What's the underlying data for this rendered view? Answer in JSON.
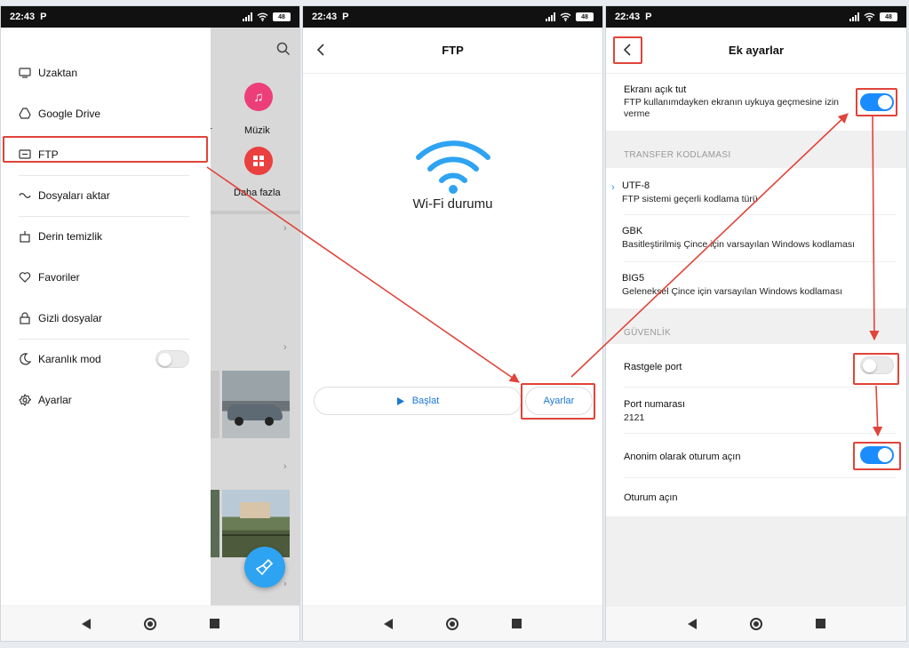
{
  "status": {
    "time": "22:43",
    "carrier_icon": "P",
    "battery": "48"
  },
  "panel1": {
    "drawer": [
      {
        "label": "Uzaktan",
        "icon": "remote-icon"
      },
      {
        "label": "Google Drive",
        "icon": "drive-icon"
      },
      {
        "label": "FTP",
        "icon": "ftp-icon"
      },
      {
        "label": "Dosyaları aktar",
        "icon": "transfer-icon"
      },
      {
        "label": "Derin temizlik",
        "icon": "clean-icon"
      },
      {
        "label": "Favoriler",
        "icon": "heart-icon"
      },
      {
        "label": "Gizli dosyalar",
        "icon": "lock-icon"
      },
      {
        "label": "Karanlık mod",
        "icon": "moon-icon"
      },
      {
        "label": "Ayarlar",
        "icon": "gear-icon"
      }
    ],
    "dark_mode_on": false,
    "bg_labels": {
      "music": "Müzik",
      "more": "Daha fazla",
      "partial": "r"
    }
  },
  "panel2": {
    "title": "FTP",
    "wifi_label": "Wi-Fi durumu",
    "start_button": "Başlat",
    "settings_button": "Ayarlar"
  },
  "panel3": {
    "title": "Ek ayarlar",
    "keep_screen": {
      "title": "Ekranı açık tut",
      "subtitle": "FTP kullanımdayken ekranın uykuya geçmesine izin verme",
      "on": true
    },
    "encoding_section": "TRANSFER KODLAMASI",
    "encodings": [
      {
        "title": "UTF-8",
        "subtitle": "FTP sistemi geçerli kodlama türü",
        "selected": true
      },
      {
        "title": "GBK",
        "subtitle": "Basitleştirilmiş Çince için varsayılan Windows kodlaması",
        "selected": false
      },
      {
        "title": "BIG5",
        "subtitle": "Geleneksel Çince için varsayılan Windows kodlaması",
        "selected": false
      }
    ],
    "security_section": "GÜVENLİK",
    "random_port": {
      "title": "Rastgele port",
      "on": false
    },
    "port": {
      "title": "Port numarası",
      "value": "2121"
    },
    "anonymous": {
      "title": "Anonim olarak oturum açın",
      "on": true
    },
    "login": {
      "title": "Oturum açın"
    }
  },
  "colors": {
    "accent": "#1a8cff",
    "highlight": "#e0443a",
    "music": "#ec3f7a",
    "more": "#ea4040"
  }
}
